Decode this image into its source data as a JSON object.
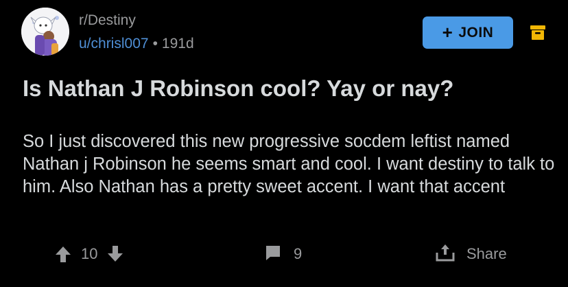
{
  "header": {
    "subreddit": "r/Destiny",
    "username": "u/chrisl007",
    "separator": "•",
    "age": "191d",
    "join_label": "JOIN",
    "join_plus": "+"
  },
  "post": {
    "title": "Is Nathan J Robinson cool? Yay or nay?",
    "body": "So I just discovered this new progressive socdem leftist named Nathan j Robinson he seems smart and cool. I want destiny to talk to him. Also Nathan has a pretty sweet accent. I want that accent"
  },
  "actions": {
    "score": "10",
    "comments": "9",
    "share_label": "Share"
  },
  "icons": {
    "upvote": "arrow-up-icon",
    "downvote": "arrow-down-icon",
    "comment": "comment-bubble-icon",
    "share": "share-icon",
    "archive": "archive-icon"
  },
  "colors": {
    "background": "#000000",
    "text": "#d7dadc",
    "muted": "#9a9b9d",
    "link": "#4f8fd6",
    "join_button": "#4a9ae6",
    "archive_icon": "#f2b705"
  }
}
